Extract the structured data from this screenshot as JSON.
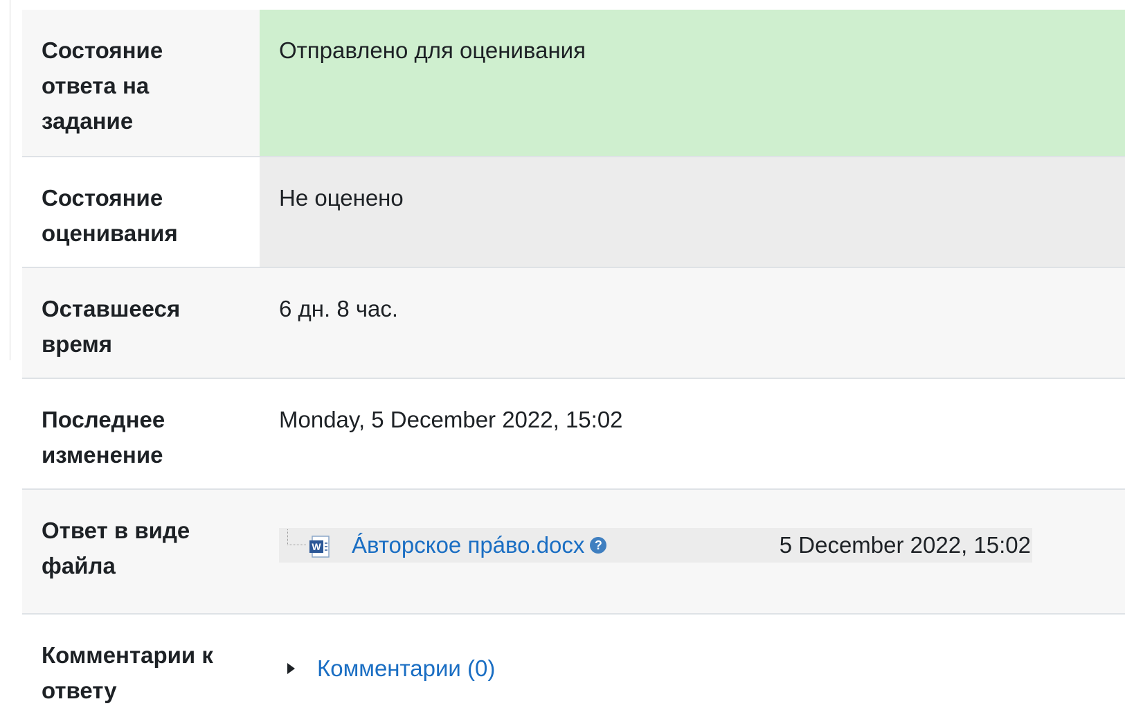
{
  "rows": {
    "submission_status": {
      "label_line1": "Состояние",
      "label_line2": "ответа на",
      "label_line3": "задание",
      "value": "Отправлено для оценивания",
      "color": "#cfefcf"
    },
    "grading_status": {
      "label_line1": "Состояние",
      "label_line2": "оценивания",
      "value": "Не оценено",
      "color": "#ececec"
    },
    "time_remaining": {
      "label_line1": "Оставшееся",
      "label_line2": "время",
      "value": "6 дн. 8 час."
    },
    "last_modified": {
      "label_line1": "Последнее",
      "label_line2": "изменение",
      "value": "Monday, 5 December 2022, 15:02"
    },
    "file_submission": {
      "label_line1": "Ответ в виде",
      "label_line2": "файла",
      "file_icon": "word-document-icon",
      "file_name": "Áвторское прáво.docx",
      "help_icon": "help-icon",
      "file_date": "5 December 2022, 15:02"
    },
    "submission_comments": {
      "label_line1": "Комментарии к",
      "label_line2": "ответу",
      "toggle_icon": "triangle-right-icon",
      "comments_link": "Комментарии (0)"
    }
  },
  "colors": {
    "link": "#1a6ec3",
    "row_light": "#f7f7f7"
  }
}
